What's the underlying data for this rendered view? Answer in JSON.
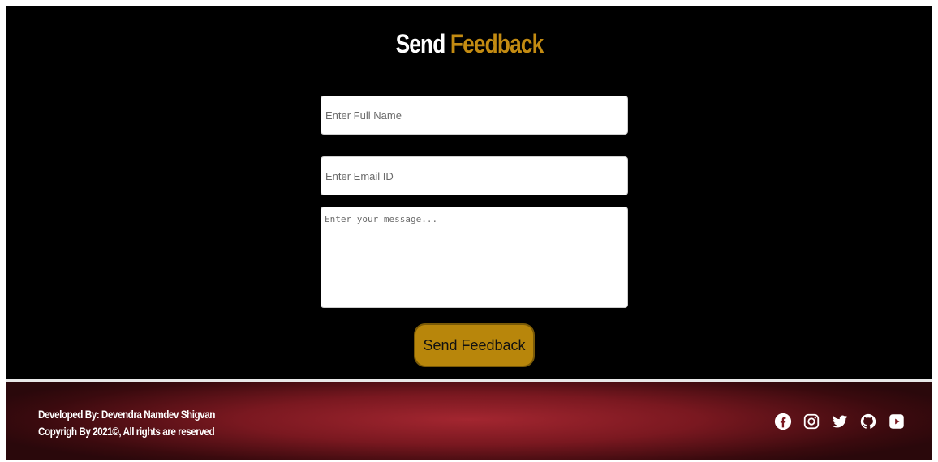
{
  "header": {
    "title_part1": "Send",
    "title_part2": "Feedback"
  },
  "form": {
    "name_placeholder": "Enter Full Name",
    "email_placeholder": "Enter Email ID",
    "message_placeholder": "Enter your message...",
    "submit_label": "Send Feedback"
  },
  "footer": {
    "developer_line": "Developed By: Devendra Namdev Shigvan",
    "copyright_line": "Copyrigh By 2021©, All rights are reserved",
    "social_icons": [
      "facebook-icon",
      "instagram-icon",
      "twitter-icon",
      "github-icon",
      "youtube-icon"
    ]
  },
  "colors": {
    "background": "#000000",
    "accent": "#c38b12",
    "button": "#b8860b",
    "footer": "#7a1820"
  }
}
